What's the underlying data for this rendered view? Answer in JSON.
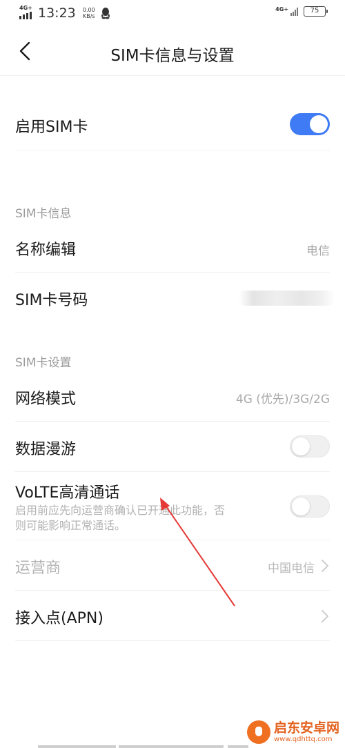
{
  "status_bar": {
    "network_left": "4G+",
    "time": "13:23",
    "speed_value": "0.00",
    "speed_unit": "KB/s",
    "network_right": "4G+",
    "battery": "75",
    "icons": [
      "signal-icon",
      "qq-icon",
      "signal-icon",
      "battery-icon"
    ]
  },
  "header": {
    "title": "SIM卡信息与设置",
    "back_icon": "chevron-left-icon"
  },
  "enable_sim": {
    "label": "启用SIM卡",
    "toggle_on": true
  },
  "sim_info": {
    "header": "SIM卡信息",
    "name_edit": {
      "label": "名称编辑",
      "value": "电信"
    },
    "sim_number": {
      "label": "SIM卡号码"
    }
  },
  "sim_settings": {
    "header": "SIM卡设置",
    "network_mode": {
      "label": "网络模式",
      "value": "4G (优先)/3G/2G"
    },
    "data_roaming": {
      "label": "数据漫游",
      "toggle_on": false
    },
    "volte": {
      "label": "VoLTE高清通话",
      "desc_line1": "启用前应先向运营商确认已开通此功能，否",
      "desc_line2": "则可能影响正常通话。",
      "toggle_on": false
    },
    "carrier": {
      "label": "运营商",
      "value": "中国电信"
    },
    "apn": {
      "label": "接入点(APN)"
    }
  },
  "watermark": {
    "text": "启东安卓网",
    "url": "www.qdhttq.com"
  },
  "colors": {
    "accent": "#3f7bf4",
    "annotation_arrow": "#e53935",
    "watermark": "#e4621f"
  }
}
